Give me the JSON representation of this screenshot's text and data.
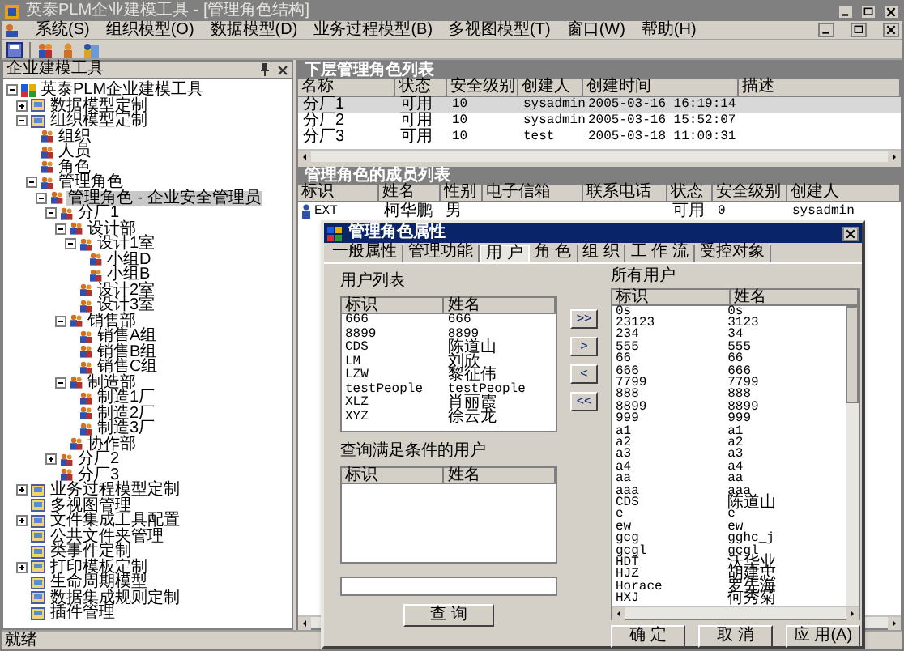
{
  "window": {
    "title": "英泰PLM企业建模工具 - [管理角色结构]"
  },
  "menu": [
    "系统(S)",
    "组织模型(O)",
    "数据模型(D)",
    "业务过程模型(B)",
    "多视图模型(T)",
    "窗口(W)",
    "帮助(H)"
  ],
  "left_pane": {
    "title": "企业建模工具",
    "tree": [
      {
        "label": "英泰PLM企业建模工具",
        "expanded": true,
        "selected": false,
        "children": [
          {
            "label": "数据模型定制",
            "expanded": false,
            "selected": false
          },
          {
            "label": "组织模型定制",
            "expanded": true,
            "selected": false,
            "children": [
              {
                "label": "组织",
                "selected": false
              },
              {
                "label": "人员",
                "selected": false
              },
              {
                "label": "角色",
                "selected": false
              },
              {
                "label": "管理角色",
                "expanded": true,
                "selected": false,
                "children": [
                  {
                    "label": "管理角色 - 企业安全管理员",
                    "expanded": true,
                    "selected": true,
                    "children": [
                      {
                        "label": "分厂1",
                        "expanded": true,
                        "selected": false,
                        "children": [
                          {
                            "label": "设计部",
                            "expanded": true,
                            "selected": false,
                            "children": [
                              {
                                "label": "设计1室",
                                "expanded": true,
                                "selected": false,
                                "children": [
                                  {
                                    "label": "小组D",
                                    "selected": false
                                  },
                                  {
                                    "label": "小组B",
                                    "selected": false
                                  }
                                ]
                              },
                              {
                                "label": "设计2室",
                                "selected": false
                              },
                              {
                                "label": "设计3室",
                                "selected": false
                              }
                            ]
                          },
                          {
                            "label": "销售部",
                            "expanded": true,
                            "selected": false,
                            "children": [
                              {
                                "label": "销售A组",
                                "selected": false
                              },
                              {
                                "label": "销售B组",
                                "selected": false
                              },
                              {
                                "label": "销售C组",
                                "selected": false
                              }
                            ]
                          },
                          {
                            "label": "制造部",
                            "expanded": true,
                            "selected": false,
                            "children": [
                              {
                                "label": "制造1厂",
                                "selected": false
                              },
                              {
                                "label": "制造2厂",
                                "selected": false
                              },
                              {
                                "label": "制造3厂",
                                "selected": false
                              }
                            ]
                          },
                          {
                            "label": "协作部",
                            "selected": false
                          }
                        ]
                      },
                      {
                        "label": "分厂2",
                        "expanded": false,
                        "selected": false
                      },
                      {
                        "label": "分厂3",
                        "selected": false
                      }
                    ]
                  }
                ]
              }
            ]
          },
          {
            "label": "业务过程模型定制",
            "expanded": false,
            "selected": false
          },
          {
            "label": "多视图管理",
            "selected": false
          },
          {
            "label": "文件集成工具配置",
            "expanded": false,
            "selected": false
          },
          {
            "label": "公共文件夹管理",
            "selected": false
          },
          {
            "label": "类事件定制",
            "selected": false
          },
          {
            "label": "打印模板定制",
            "expanded": false,
            "selected": false
          },
          {
            "label": "生命周期模型",
            "selected": false
          },
          {
            "label": "数据集成规则定制",
            "selected": false
          },
          {
            "label": "插件管理",
            "selected": false
          }
        ]
      }
    ]
  },
  "sub_roles": {
    "title": "下层管理角色列表",
    "columns": [
      "名称",
      "状态",
      "安全级别",
      "创建人",
      "创建时间",
      "描述"
    ],
    "rows": [
      {
        "cells": [
          "分厂1",
          "可用",
          "10",
          "sysadmin",
          "2005-03-16 16:19:14"
        ],
        "selected": true
      },
      {
        "cells": [
          "分厂2",
          "可用",
          "10",
          "sysadmin",
          "2005-03-16 15:52:07"
        ],
        "selected": false
      },
      {
        "cells": [
          "分厂3",
          "可用",
          "10",
          "test",
          "2005-03-18 11:00:31"
        ],
        "selected": false
      }
    ]
  },
  "members": {
    "title": "管理角色的成员列表",
    "columns": [
      "标识",
      "姓名",
      "性别",
      "电子信箱",
      "联系电话",
      "状态",
      "安全级别",
      "创建人"
    ],
    "rows": [
      {
        "id": "EXT",
        "name": "柯华鹏",
        "gender": "男",
        "status": "可用",
        "security": "0",
        "creator": "sysadmin"
      }
    ]
  },
  "dialog": {
    "title": "管理角色属性",
    "tabs": [
      {
        "label": "一般属性",
        "selected": false
      },
      {
        "label": "管理功能",
        "selected": false
      },
      {
        "label": "用 户",
        "selected": true
      },
      {
        "label": "角 色",
        "selected": false
      },
      {
        "label": "组 织",
        "selected": false
      },
      {
        "label": "工 作 流",
        "selected": false
      },
      {
        "label": "受控对象",
        "selected": false
      }
    ],
    "user_list": {
      "title": "用户列表",
      "columns": [
        "标识",
        "姓名"
      ],
      "rows": [
        [
          "666",
          "666"
        ],
        [
          "8899",
          "8899"
        ],
        [
          "CDS",
          "陈道山"
        ],
        [
          "LM",
          "刘欣"
        ],
        [
          "LZW",
          "黎征伟"
        ],
        [
          "testPeople",
          "testPeople"
        ],
        [
          "XLZ",
          "肖丽霞"
        ],
        [
          "XYZ",
          "徐云龙"
        ]
      ]
    },
    "move_buttons": [
      ">>",
      ">",
      "<",
      "<<"
    ],
    "query": {
      "title": "查询满足条件的用户",
      "columns": [
        "标识",
        "姓名"
      ],
      "button": "查 询"
    },
    "all_users": {
      "title": "所有用户",
      "columns": [
        "标识",
        "姓名"
      ],
      "rows": [
        [
          "0s",
          "0s"
        ],
        [
          "23123",
          "3123"
        ],
        [
          "234",
          "34"
        ],
        [
          "555",
          "555"
        ],
        [
          "66",
          "66"
        ],
        [
          "666",
          "666"
        ],
        [
          "7799",
          "7799"
        ],
        [
          "888",
          "888"
        ],
        [
          "8899",
          "8899"
        ],
        [
          "999",
          "999"
        ],
        [
          "a1",
          "a1"
        ],
        [
          "a2",
          "a2"
        ],
        [
          "a3",
          "a3"
        ],
        [
          "a4",
          "a4"
        ],
        [
          "aa",
          "aa"
        ],
        [
          "aaa",
          "aaa"
        ],
        [
          "CDS",
          "陈道山"
        ],
        [
          "e",
          "e"
        ],
        [
          "ew",
          "ew"
        ],
        [
          "gcg",
          "gghc_j"
        ],
        [
          "gcgl",
          "gcgl"
        ],
        [
          "HDT",
          "沃华业"
        ],
        [
          "HJZ",
          "胡建忠"
        ],
        [
          "Horace",
          "罗先海"
        ],
        [
          "HXJ",
          "何秀菊"
        ]
      ]
    },
    "buttons": [
      "确 定",
      "取 消",
      "应 用(A)"
    ]
  },
  "status_bar": "就绪"
}
